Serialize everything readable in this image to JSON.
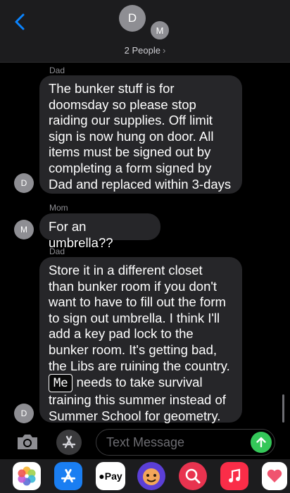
{
  "header": {
    "avatar_primary": "D",
    "avatar_secondary": "M",
    "people_label": "2 People",
    "chevron": "›"
  },
  "messages": [
    {
      "sender": "Dad",
      "avatar": "D",
      "lines": [
        "The bunker stuff is for",
        "doomsday so please stop",
        "raiding our supplies.  Off limit",
        "sign is now hung on door.  All",
        "items must be signed out by",
        "completing a form signed by",
        "Dad and replaced within 3-days"
      ]
    },
    {
      "sender": "Mom",
      "avatar": "M",
      "lines": [
        "For an umbrella??"
      ]
    },
    {
      "sender": "Dad",
      "avatar": "D",
      "lines": [
        "Store it in a different closet",
        "than bunker room if you don't",
        "want to have to fill out the form",
        "to sign out umbrella.  I think I'll",
        "add a key pad lock to the",
        "bunker room.  It's getting bad,",
        "the Libs are ruining the country."
      ],
      "redacted_label": "Me",
      "after_redaction": " needs to take survival",
      "tail_lines": [
        "training this summer instead of",
        "Summer School for geometry."
      ]
    }
  ],
  "composer": {
    "placeholder": "Text Message",
    "camera_icon": "camera-icon",
    "apps_icon": "app-store-icon",
    "send_icon": "arrow-up-icon"
  },
  "app_drawer": {
    "apple_pay_label": "Pay",
    "apps": [
      "photos",
      "app-store",
      "apple-pay",
      "memoji",
      "search-images",
      "music",
      "digital-touch"
    ]
  },
  "colors": {
    "bubble": "#262629",
    "send": "#34c759",
    "ios_blue": "#0a84ff"
  }
}
